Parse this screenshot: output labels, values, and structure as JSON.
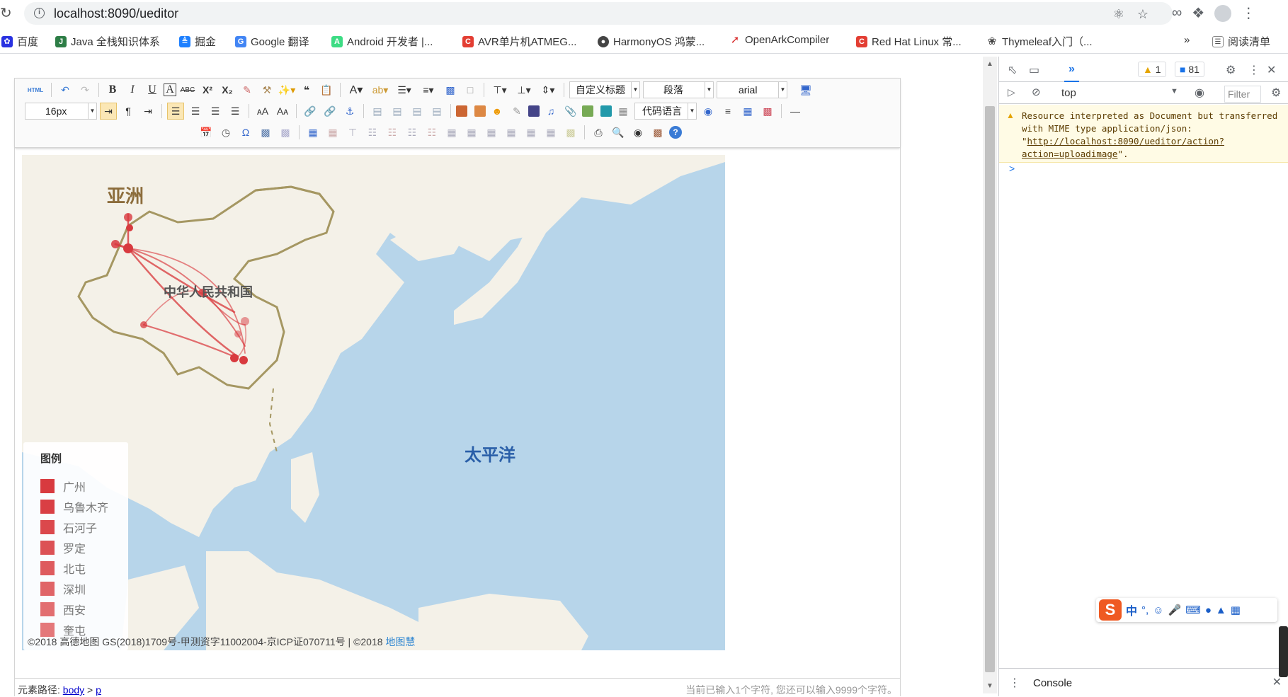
{
  "browser": {
    "url": "localhost:8090/ueditor",
    "bookmarks": [
      {
        "label": "百度",
        "icon": "baidu-icon",
        "color": "#2932e1"
      },
      {
        "label": "Java 全栈知识体系",
        "icon": "book-icon",
        "color": "#2d7d46"
      },
      {
        "label": "掘金",
        "icon": "juejin-icon",
        "color": "#1e80ff"
      },
      {
        "label": "Google 翻译",
        "icon": "google-translate-icon",
        "color": "#4285f4"
      },
      {
        "label": "Android 开发者 |...",
        "icon": "android-icon",
        "color": "#3ddc84"
      },
      {
        "label": "AVR单片机ATMEG...",
        "icon": "csdn-icon",
        "color": "#e33e33"
      },
      {
        "label": "HarmonyOS 鸿蒙...",
        "icon": "harmonyos-icon",
        "color": "#444444"
      },
      {
        "label": "OpenArkCompiler",
        "icon": "gitee-icon",
        "color": "#d82c2c"
      },
      {
        "label": "Red Hat Linux 常...",
        "icon": "csdn-icon",
        "color": "#e33e33"
      },
      {
        "label": "Thymeleaf入门（...",
        "icon": "thymeleaf-icon",
        "color": "#444444"
      }
    ],
    "reading_list": "阅读清单"
  },
  "editor": {
    "font_size": "16px",
    "custom_heading": "自定义标题",
    "paragraph": "段落",
    "font_family": "arial",
    "code_language": "代码语言",
    "path_label": "元素路径:",
    "path_body": "body",
    "path_sep": ">",
    "path_p": "p",
    "char_count": "当前已输入1个字符, 您还可以输入9999个字符。"
  },
  "map": {
    "label_asia": "亚洲",
    "label_china": "中华人民共和国",
    "label_pacific": "太平洋",
    "legend_title": "图例",
    "legend_items": [
      {
        "label": "广州",
        "color": "#d83a3f"
      },
      {
        "label": "乌鲁木齐",
        "color": "#d93f44"
      },
      {
        "label": "石河子",
        "color": "#db484c"
      },
      {
        "label": "罗定",
        "color": "#dc5155"
      },
      {
        "label": "北屯",
        "color": "#de5b5e"
      },
      {
        "label": "深圳",
        "color": "#e06467"
      },
      {
        "label": "西安",
        "color": "#e26e70"
      },
      {
        "label": "奎屯",
        "color": "#e4787a"
      }
    ],
    "copyright": "©2018 高德地图 GS(2018)1709号-甲测资字11002004-京ICP证070711号 | ©2018 ",
    "copyright_brand": "地图慧"
  },
  "devtools": {
    "more_tabs": "»",
    "warnings_count": "1",
    "messages_count": "81",
    "context": "top",
    "filter_placeholder": "Filter",
    "warning_text_1": "Resource interpreted as Document but transferred with MIME type application/json: \"",
    "warning_link": "http://localhost:8090/ueditor/action?action=uploadimage",
    "warning_text_2": "\".",
    "prompt": ">",
    "drawer_tab": "Console"
  },
  "ime": {
    "mode": "中",
    "punct": "°,"
  }
}
